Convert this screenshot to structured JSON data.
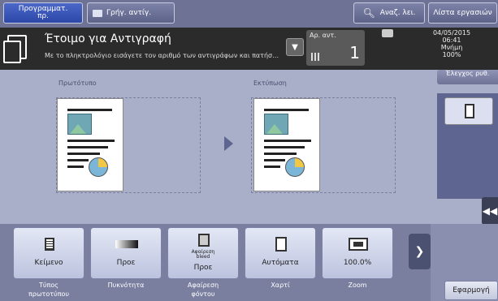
{
  "topbar": {
    "program_label": "Προγραμματ.\nπρ.",
    "quick_copy_label": "Γρήγ. αντίγ.",
    "search_label": "Αναζ. λει.",
    "job_list_label": "Λίστα εργασιών"
  },
  "status": {
    "title": "Έτοιμο για Αντιγραφή",
    "message": "Με το πληκτρολόγιο εισάγετε τον αριθμό των αντιγράφων και πατήστε Start.",
    "copies_label": "Αρ. αντ.",
    "copies_value": "1",
    "date": "04/05/2015",
    "time": "06:41",
    "memory_label": "Μνήμη",
    "memory_value": "100%"
  },
  "preview": {
    "original_label": "Πρωτότυπο",
    "output_label": "Εκτύπωση"
  },
  "right_panel": {
    "check_label": "Έλεγχος ρυθ."
  },
  "functions": [
    {
      "name": "original-type",
      "icon": "document-icon",
      "value": "Κείμενο",
      "label": "Τύπος\nπρωτοτύπου"
    },
    {
      "name": "density",
      "icon": "density-icon",
      "value": "Προε",
      "label": "Πυκνότητα"
    },
    {
      "name": "background-removal",
      "icon": "background-removal-icon",
      "value": "Προε",
      "label": "Αφαίρεση\nφόντου",
      "icon_text": "Αφαίρεση\nbleed"
    },
    {
      "name": "paper",
      "icon": "paper-icon",
      "value": "Αυτόματα",
      "label": "Χαρτί"
    },
    {
      "name": "zoom",
      "icon": "zoom-icon",
      "value": "100.0%",
      "label": "Zoom"
    }
  ],
  "apply_label": "Εφαρμογή"
}
